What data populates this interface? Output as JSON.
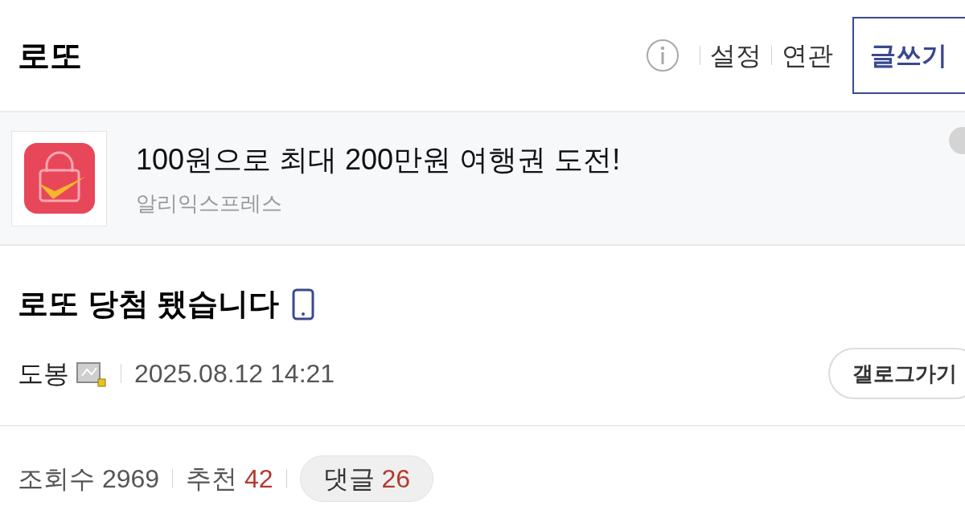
{
  "header": {
    "title": "로또",
    "links": [
      "설정",
      "연관"
    ],
    "write_button": "글쓰기"
  },
  "ad": {
    "headline": "100원으로 최대 200만원 여행권 도전!",
    "advertiser": "알리익스프레스"
  },
  "post": {
    "title": "로또 당첨 됐습니다",
    "author": "도봉",
    "date": "2025.08.12 14:21",
    "gallery_button": "갤로그가기"
  },
  "stats": [
    {
      "kind": "stat",
      "label": "조회수",
      "value": "2969",
      "highlight": false
    },
    {
      "kind": "stat",
      "label": "추천",
      "value": "42",
      "highlight": true
    },
    {
      "kind": "pill",
      "label": "댓글",
      "value": "26",
      "highlight": true
    }
  ]
}
